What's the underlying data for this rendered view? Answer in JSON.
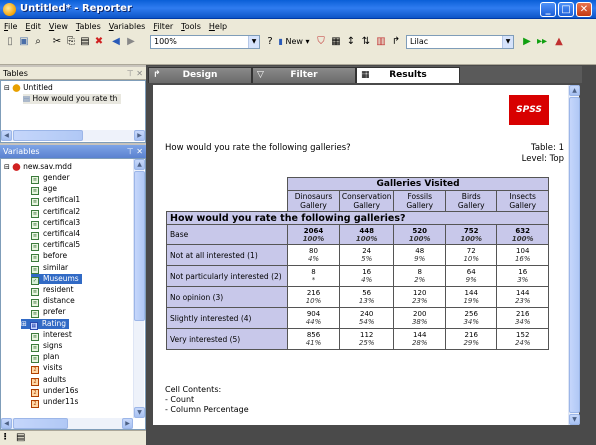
{
  "window": {
    "title": "Untitled* - Reporter"
  },
  "menu": [
    "File",
    "Edit",
    "View",
    "Tables",
    "Variables",
    "Filter",
    "Tools",
    "Help"
  ],
  "toolbar": {
    "zoom": "100%",
    "new_label": "New",
    "style": "Lilac"
  },
  "tables_pane": {
    "title": "Tables",
    "root": "Untitled",
    "table_item": "How would you rate th"
  },
  "variables_pane": {
    "title": "Variables",
    "root": "new.sav.mdd",
    "items": [
      {
        "label": "gender",
        "kind": "var"
      },
      {
        "label": "age",
        "kind": "var"
      },
      {
        "label": "certifical1",
        "kind": "var"
      },
      {
        "label": "certifical2",
        "kind": "var"
      },
      {
        "label": "certifical3",
        "kind": "var"
      },
      {
        "label": "certifical4",
        "kind": "var"
      },
      {
        "label": "certifical5",
        "kind": "var"
      },
      {
        "label": "before",
        "kind": "var"
      },
      {
        "label": "similar",
        "kind": "var"
      },
      {
        "label": "Museums",
        "kind": "check"
      },
      {
        "label": "resident",
        "kind": "var"
      },
      {
        "label": "distance",
        "kind": "var"
      },
      {
        "label": "prefer",
        "kind": "var"
      },
      {
        "label": "Rating",
        "kind": "grid"
      },
      {
        "label": "interest",
        "kind": "var"
      },
      {
        "label": "signs",
        "kind": "var"
      },
      {
        "label": "plan",
        "kind": "var"
      },
      {
        "label": "visits",
        "kind": "ord"
      },
      {
        "label": "adults",
        "kind": "ord"
      },
      {
        "label": "under16s",
        "kind": "ord"
      },
      {
        "label": "under11s",
        "kind": "ord"
      }
    ]
  },
  "tabs": {
    "design": "Design",
    "filter": "Filter",
    "results": "Results"
  },
  "report": {
    "logo": "SPSS",
    "question": "How would you rate the following galleries?",
    "table_no": "Table: 1",
    "level": "Level: Top",
    "banner": "Galleries Visited",
    "columns": [
      "Dinosaurs Gallery",
      "Conservation Gallery",
      "Fossils Gallery",
      "Birds Gallery",
      "Insects Gallery"
    ],
    "table_title": "How would you rate the following galleries?",
    "rows": [
      {
        "label": "Base",
        "count": [
          "2064",
          "448",
          "520",
          "752",
          "632"
        ],
        "pct": [
          "100%",
          "100%",
          "100%",
          "100%",
          "100%"
        ]
      },
      {
        "label": "Not at all interested (1)",
        "count": [
          "80",
          "24",
          "48",
          "72",
          "104"
        ],
        "pct": [
          "4%",
          "5%",
          "9%",
          "10%",
          "16%"
        ]
      },
      {
        "label": "Not particularly interested (2)",
        "count": [
          "8",
          "16",
          "8",
          "64",
          "16"
        ],
        "pct": [
          "*",
          "4%",
          "2%",
          "9%",
          "3%"
        ]
      },
      {
        "label": "No opinion (3)",
        "count": [
          "216",
          "56",
          "120",
          "144",
          "144"
        ],
        "pct": [
          "10%",
          "13%",
          "23%",
          "19%",
          "23%"
        ]
      },
      {
        "label": "Slightly interested (4)",
        "count": [
          "904",
          "240",
          "200",
          "256",
          "216"
        ],
        "pct": [
          "44%",
          "54%",
          "38%",
          "34%",
          "34%"
        ]
      },
      {
        "label": "Very interested (5)",
        "count": [
          "856",
          "112",
          "144",
          "216",
          "152"
        ],
        "pct": [
          "41%",
          "25%",
          "28%",
          "29%",
          "24%"
        ]
      }
    ],
    "cell_contents_title": "Cell Contents:",
    "cell_contents": [
      "- Count",
      "- Column Percentage"
    ]
  }
}
